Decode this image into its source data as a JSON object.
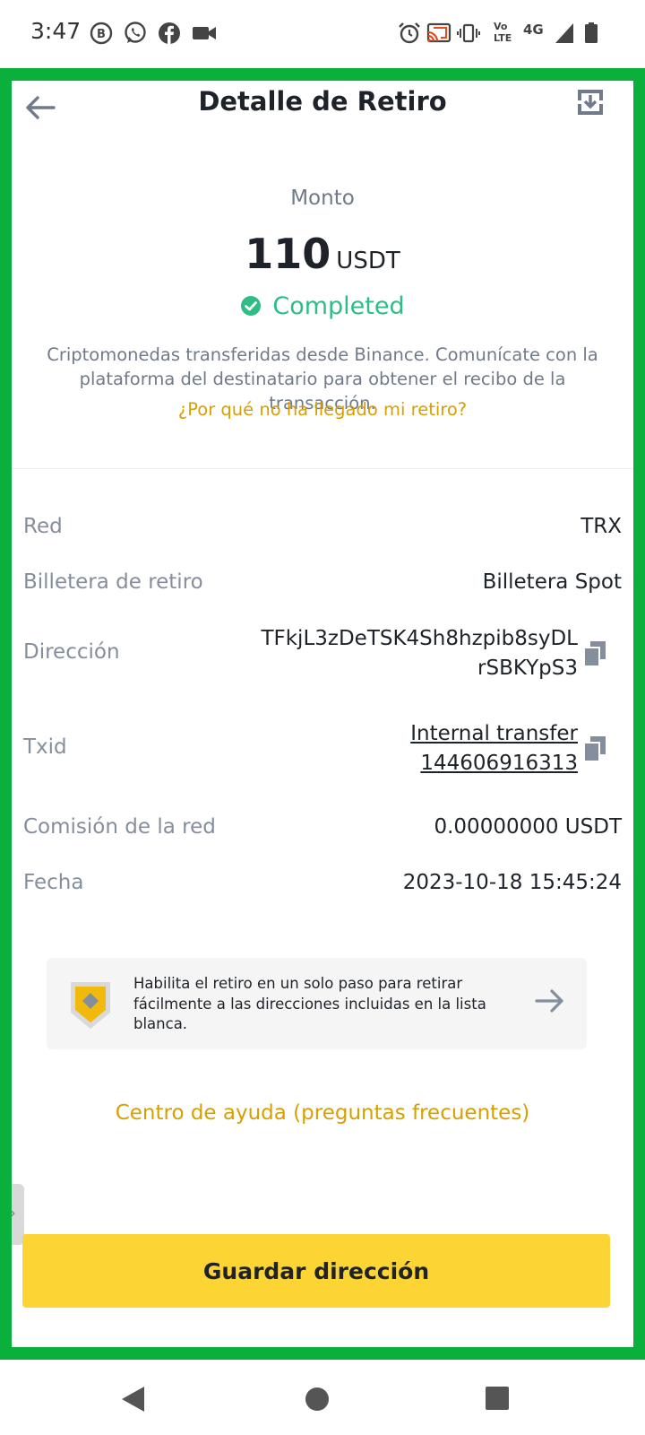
{
  "status_bar": {
    "time": "3:47",
    "left_icons": [
      "b-badge-icon",
      "whatsapp-icon",
      "facebook-icon",
      "video-camera-icon"
    ],
    "right_icons": [
      "alarm-icon",
      "cast-icon",
      "vibrate-icon",
      "volte-icon",
      "4g-icon",
      "signal-icon",
      "battery-icon"
    ],
    "volte_text": "Vo LTE",
    "network_text": "4G"
  },
  "header": {
    "title": "Detalle de Retiro"
  },
  "summary": {
    "amount_label": "Monto",
    "amount": "110",
    "unit": "USDT",
    "status": "Completed",
    "description": "Criptomonedas transferidas desde Binance. Comunícate con la plataforma del destinatario para obtener el recibo de la transacción.",
    "why_link": "¿Por qué no ha llegado mi retiro?"
  },
  "details": {
    "network_label": "Red",
    "network_value": "TRX",
    "wallet_label": "Billetera de retiro",
    "wallet_value": "Billetera Spot",
    "address_label": "Dirección",
    "address_line1": "TFkjL3zDeTSK4Sh8hzpib8syDL",
    "address_line2": "rSBKYpS3",
    "txid_label": "Txid",
    "txid_line1": "Internal transfer",
    "txid_line2": "144606916313",
    "fee_label": "Comisión de la red",
    "fee_value": "0.00000000 USDT",
    "date_label": "Fecha",
    "date_value": "2023-10-18 15:45:24"
  },
  "banner": {
    "text": "Habilita el retiro en un solo paso para retirar fácilmente a las direcciones incluidas en la lista blanca."
  },
  "help_link": "Centro de ayuda (preguntas frecuentes)",
  "save_button": "Guardar dirección",
  "colors": {
    "frame": "#0aaf3c",
    "success": "#2ebd85",
    "accent_link": "#d89f00",
    "button": "#fcd535"
  }
}
